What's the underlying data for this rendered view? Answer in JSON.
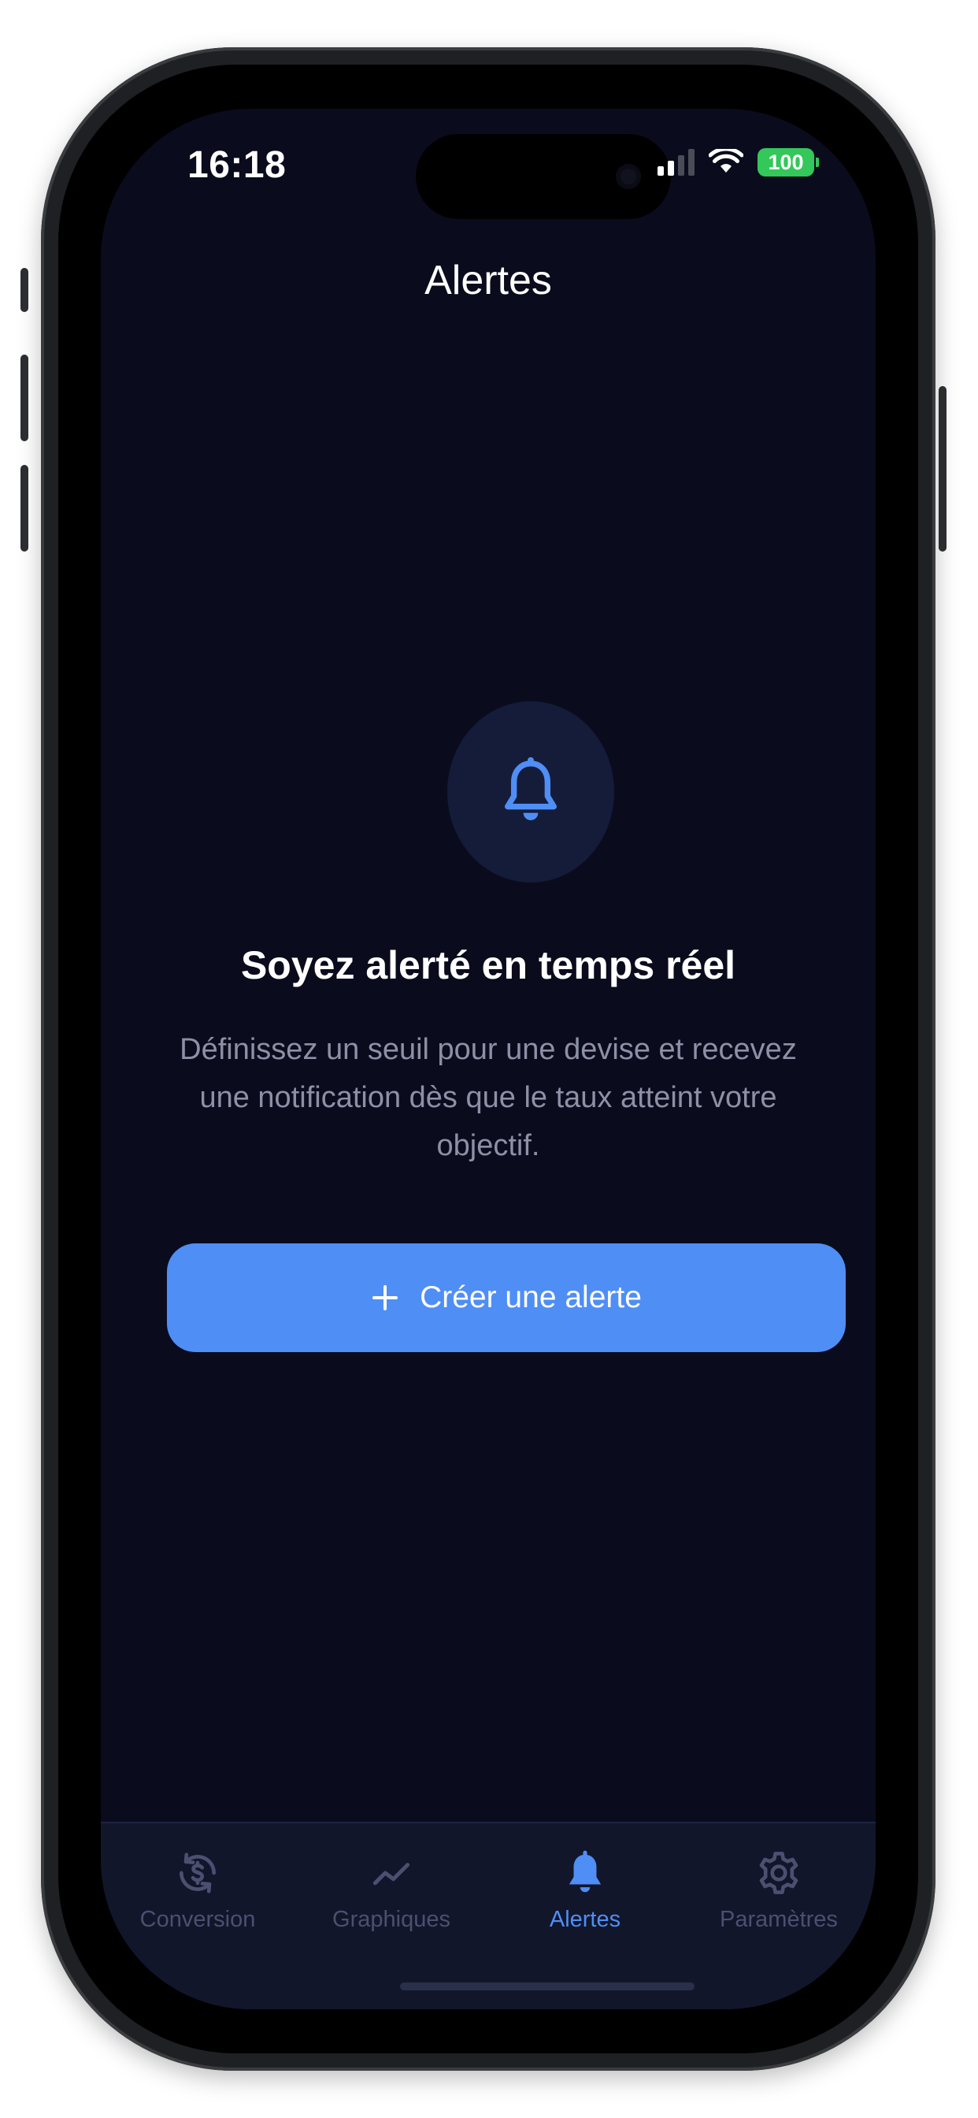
{
  "status_bar": {
    "time": "16:18",
    "battery": "100"
  },
  "header": {
    "title": "Alertes"
  },
  "empty_state": {
    "icon": "bell-icon",
    "title": "Soyez alerté en temps réel",
    "description": "Définissez un seuil pour une devise et recevez une notification dès que le taux atteint votre objectif.",
    "cta_label": "Créer une alerte",
    "cta_icon": "plus-icon"
  },
  "tab_bar": {
    "items": [
      {
        "label": "Conversion",
        "icon": "currency-exchange-icon"
      },
      {
        "label": "Graphiques",
        "icon": "trend-line-icon"
      },
      {
        "label": "Alertes",
        "icon": "bell-icon"
      },
      {
        "label": "Paramètres",
        "icon": "gear-icon"
      }
    ],
    "active": "Alertes"
  },
  "colors": {
    "background": "#0a0c1d",
    "accent": "#4f8ef5",
    "muted_text": "#8d90a6",
    "tab_inactive": "#4b5070",
    "battery": "#34c759"
  }
}
